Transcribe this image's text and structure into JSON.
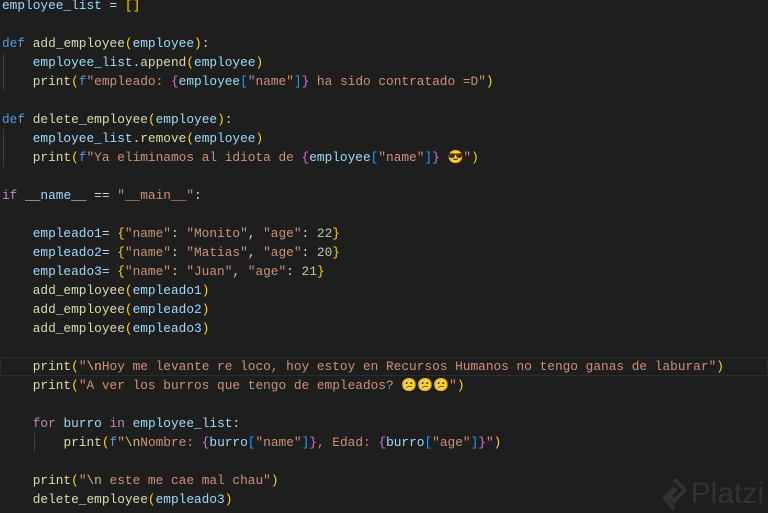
{
  "current_line": 19,
  "watermark": "Platzi",
  "lines": [
    [
      [
        "employee_list",
        "v"
      ],
      [
        " = ",
        "p"
      ],
      [
        "[]",
        "b1"
      ]
    ],
    [],
    [
      [
        "def",
        "k"
      ],
      [
        " ",
        "p"
      ],
      [
        "add_employee",
        "f"
      ],
      [
        "(",
        "b1"
      ],
      [
        "employee",
        "v"
      ],
      [
        ")",
        "b1"
      ],
      [
        ":",
        "p"
      ]
    ],
    [
      [
        "    ",
        "p"
      ],
      [
        "employee_list",
        "v"
      ],
      [
        ".",
        "p"
      ],
      [
        "append",
        "f"
      ],
      [
        "(",
        "b1"
      ],
      [
        "employee",
        "v"
      ],
      [
        ")",
        "b1"
      ]
    ],
    [
      [
        "    ",
        "p"
      ],
      [
        "print",
        "f"
      ],
      [
        "(",
        "b1"
      ],
      [
        "f",
        "k"
      ],
      [
        "\"empleado: ",
        "s"
      ],
      [
        "{",
        "b2"
      ],
      [
        "employee",
        "v"
      ],
      [
        "[",
        "b3"
      ],
      [
        "\"name\"",
        "s"
      ],
      [
        "]",
        "b3"
      ],
      [
        "}",
        "b2"
      ],
      [
        " ha sido contratado =D\"",
        "s"
      ],
      [
        ")",
        "b1"
      ]
    ],
    [],
    [
      [
        "def",
        "k"
      ],
      [
        " ",
        "p"
      ],
      [
        "delete_employee",
        "f"
      ],
      [
        "(",
        "b1"
      ],
      [
        "employee",
        "v"
      ],
      [
        ")",
        "b1"
      ],
      [
        ":",
        "p"
      ]
    ],
    [
      [
        "    ",
        "p"
      ],
      [
        "employee_list",
        "v"
      ],
      [
        ".",
        "p"
      ],
      [
        "remove",
        "f"
      ],
      [
        "(",
        "b1"
      ],
      [
        "employee",
        "v"
      ],
      [
        ")",
        "b1"
      ]
    ],
    [
      [
        "    ",
        "p"
      ],
      [
        "print",
        "f"
      ],
      [
        "(",
        "b1"
      ],
      [
        "f",
        "k"
      ],
      [
        "\"Ya eliminamos al idiota de ",
        "s"
      ],
      [
        "{",
        "b2"
      ],
      [
        "employee",
        "v"
      ],
      [
        "[",
        "b3"
      ],
      [
        "\"name\"",
        "s"
      ],
      [
        "]",
        "b3"
      ],
      [
        "}",
        "b2"
      ],
      [
        " 😎\"",
        "s"
      ],
      [
        ")",
        "b1"
      ]
    ],
    [],
    [
      [
        "if",
        "c"
      ],
      [
        " ",
        "p"
      ],
      [
        "__name__",
        "v"
      ],
      [
        " == ",
        "p"
      ],
      [
        "\"__main__\"",
        "s"
      ],
      [
        ":",
        "p"
      ]
    ],
    [],
    [
      [
        "    ",
        "p"
      ],
      [
        "empleado1",
        "v"
      ],
      [
        "= ",
        "p"
      ],
      [
        "{",
        "b1"
      ],
      [
        "\"name\"",
        "s"
      ],
      [
        ": ",
        "p"
      ],
      [
        "\"Monito\"",
        "s"
      ],
      [
        ", ",
        "p"
      ],
      [
        "\"age\"",
        "s"
      ],
      [
        ": ",
        "p"
      ],
      [
        "22",
        "n"
      ],
      [
        "}",
        "b1"
      ]
    ],
    [
      [
        "    ",
        "p"
      ],
      [
        "empleado2",
        "v"
      ],
      [
        "= ",
        "p"
      ],
      [
        "{",
        "b1"
      ],
      [
        "\"name\"",
        "s"
      ],
      [
        ": ",
        "p"
      ],
      [
        "\"Matias\"",
        "s"
      ],
      [
        ", ",
        "p"
      ],
      [
        "\"age\"",
        "s"
      ],
      [
        ": ",
        "p"
      ],
      [
        "20",
        "n"
      ],
      [
        "}",
        "b1"
      ]
    ],
    [
      [
        "    ",
        "p"
      ],
      [
        "empleado3",
        "v"
      ],
      [
        "= ",
        "p"
      ],
      [
        "{",
        "b1"
      ],
      [
        "\"name\"",
        "s"
      ],
      [
        ": ",
        "p"
      ],
      [
        "\"Juan\"",
        "s"
      ],
      [
        ", ",
        "p"
      ],
      [
        "\"age\"",
        "s"
      ],
      [
        ": ",
        "p"
      ],
      [
        "21",
        "n"
      ],
      [
        "}",
        "b1"
      ]
    ],
    [
      [
        "    ",
        "p"
      ],
      [
        "add_employee",
        "f"
      ],
      [
        "(",
        "b1"
      ],
      [
        "empleado1",
        "v"
      ],
      [
        ")",
        "b1"
      ]
    ],
    [
      [
        "    ",
        "p"
      ],
      [
        "add_employee",
        "f"
      ],
      [
        "(",
        "b1"
      ],
      [
        "empleado2",
        "v"
      ],
      [
        ")",
        "b1"
      ]
    ],
    [
      [
        "    ",
        "p"
      ],
      [
        "add_employee",
        "f"
      ],
      [
        "(",
        "b1"
      ],
      [
        "empleado3",
        "v"
      ],
      [
        ")",
        "b1"
      ]
    ],
    [],
    [
      [
        "    ",
        "p"
      ],
      [
        "print",
        "f"
      ],
      [
        "(",
        "b1"
      ],
      [
        "\"",
        "s"
      ],
      [
        "\\n",
        "e"
      ],
      [
        "Hoy me levante re loco, hoy estoy en Recursos Humanos no tengo ganas de laburar\"",
        "s"
      ],
      [
        ")",
        "b1"
      ]
    ],
    [
      [
        "    ",
        "p"
      ],
      [
        "print",
        "f"
      ],
      [
        "(",
        "b1"
      ],
      [
        "\"A ver los burros que tengo de empleados? 😕😕😕\"",
        "s"
      ],
      [
        ")",
        "b1"
      ]
    ],
    [],
    [
      [
        "    ",
        "p"
      ],
      [
        "for",
        "c"
      ],
      [
        " ",
        "p"
      ],
      [
        "burro",
        "v"
      ],
      [
        " ",
        "p"
      ],
      [
        "in",
        "c"
      ],
      [
        " ",
        "p"
      ],
      [
        "employee_list",
        "v"
      ],
      [
        ":",
        "p"
      ]
    ],
    [
      [
        "        ",
        "p"
      ],
      [
        "print",
        "f"
      ],
      [
        "(",
        "b1"
      ],
      [
        "f",
        "k"
      ],
      [
        "\"",
        "s"
      ],
      [
        "\\n",
        "e"
      ],
      [
        "Nombre: ",
        "s"
      ],
      [
        "{",
        "b2"
      ],
      [
        "burro",
        "v"
      ],
      [
        "[",
        "b3"
      ],
      [
        "\"name\"",
        "s"
      ],
      [
        "]",
        "b3"
      ],
      [
        "}",
        "b2"
      ],
      [
        ", Edad: ",
        "s"
      ],
      [
        "{",
        "b2"
      ],
      [
        "burro",
        "v"
      ],
      [
        "[",
        "b3"
      ],
      [
        "\"age\"",
        "s"
      ],
      [
        "]",
        "b3"
      ],
      [
        "}",
        "b2"
      ],
      [
        "\"",
        "s"
      ],
      [
        ")",
        "b1"
      ]
    ],
    [],
    [
      [
        "    ",
        "p"
      ],
      [
        "print",
        "f"
      ],
      [
        "(",
        "b1"
      ],
      [
        "\"",
        "s"
      ],
      [
        "\\n",
        "e"
      ],
      [
        " este me cae mal chau\"",
        "s"
      ],
      [
        ")",
        "b1"
      ]
    ],
    [
      [
        "    ",
        "p"
      ],
      [
        "delete_employee",
        "f"
      ],
      [
        "(",
        "b1"
      ],
      [
        "empleado3",
        "v"
      ],
      [
        ")",
        "b1"
      ]
    ]
  ]
}
